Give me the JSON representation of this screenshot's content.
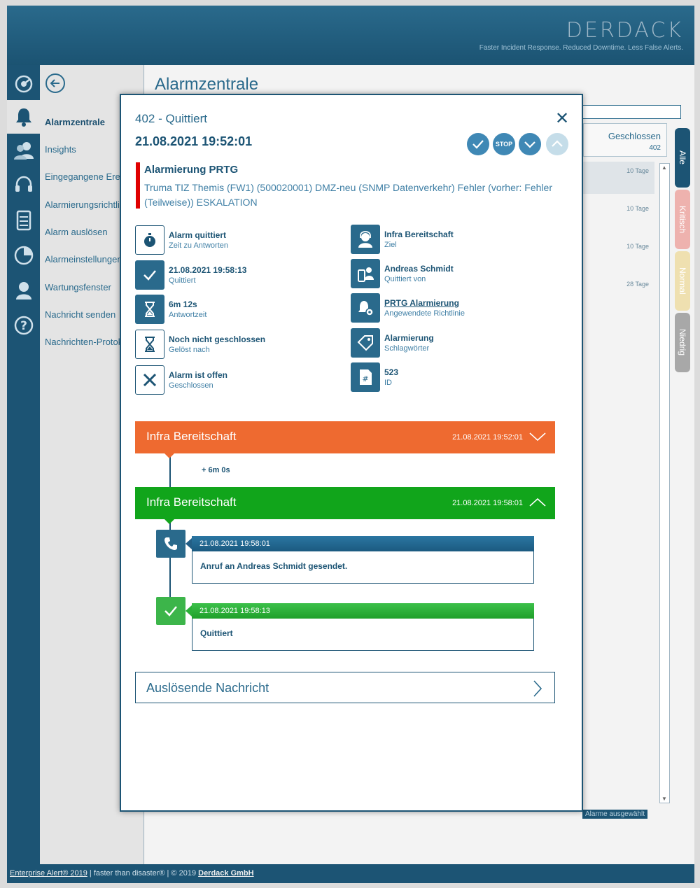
{
  "header": {
    "logo": "DERDACK",
    "tagline": "Faster Incident Response. Reduced Downtime. Less False Alerts."
  },
  "sidebar": {
    "items": [
      {
        "label": "Alarmzentrale",
        "active": true
      },
      {
        "label": "Insights"
      },
      {
        "label": "Eingegangene Ereignisse"
      },
      {
        "label": "Alarmierungsrichtlinien"
      },
      {
        "label": "Alarm auslösen"
      },
      {
        "label": "Alarmeinstellungen"
      },
      {
        "label": "Wartungsfenster"
      },
      {
        "label": "Nachricht senden"
      },
      {
        "label": "Nachrichten-Protokoll"
      }
    ]
  },
  "main": {
    "title": "Alarmzentrale",
    "closed_filter": {
      "label": "Geschlossen",
      "count": "402"
    },
    "rows": [
      "10 Tage",
      "10 Tage",
      "10 Tage",
      "28 Tage"
    ],
    "tabs": [
      "Alle",
      "Kritisch",
      "Normal",
      "Niedrig"
    ],
    "selection_info": "Alarme ausgewählt"
  },
  "modal": {
    "title": "402 - Quittiert",
    "close": "✕",
    "datetime": "21.08.2021 19:52:01",
    "stop_label": "STOP",
    "alert_title": "Alarmierung PRTG",
    "alert_desc": "Truma TIZ Themis (FW1) (500020001) DMZ-neu (SNMP Datenverkehr) Fehler (vorher: Fehler (Teilweise)) ESKALATION",
    "info_left": [
      {
        "value": "Alarm quittiert",
        "label": "Zeit zu Antworten"
      },
      {
        "value": "21.08.2021 19:58:13",
        "label": "Quittiert"
      },
      {
        "value": "6m 12s",
        "label": "Antwortzeit"
      },
      {
        "value": "Noch nicht geschlossen",
        "label": "Gelöst nach"
      },
      {
        "value": "Alarm ist offen",
        "label": "Geschlossen"
      }
    ],
    "info_right": [
      {
        "value": "Infra Bereitschaft",
        "label": "Ziel"
      },
      {
        "value": "Andreas Schmidt",
        "label": "Quittiert von"
      },
      {
        "value": "PRTG Alarmierung",
        "label": "Angewendete Richtlinie"
      },
      {
        "value": "Alarmierung",
        "label": "Schlagwörter"
      },
      {
        "value": "523",
        "label": "ID"
      }
    ],
    "steps": [
      {
        "name": "Infra Bereitschaft",
        "time": "21.08.2021 19:52:01",
        "color": "#ee6a30"
      },
      {
        "name": "Infra Bereitschaft",
        "time": "21.08.2021 19:58:01",
        "color": "#11a51b"
      }
    ],
    "delay": "+ 6m 0s",
    "events": [
      {
        "time": "21.08.2021 19:58:01",
        "text": "Anruf an Andreas Schmidt gesendet."
      },
      {
        "time": "21.08.2021 19:58:13",
        "text": "Quittiert"
      }
    ],
    "trigger_message": "Auslösende Nachricht"
  },
  "footer": {
    "product": "Enterprise Alert® 2019",
    "slogan": " | faster than disaster® | © 2019 ",
    "company": "Derdack GmbH"
  }
}
